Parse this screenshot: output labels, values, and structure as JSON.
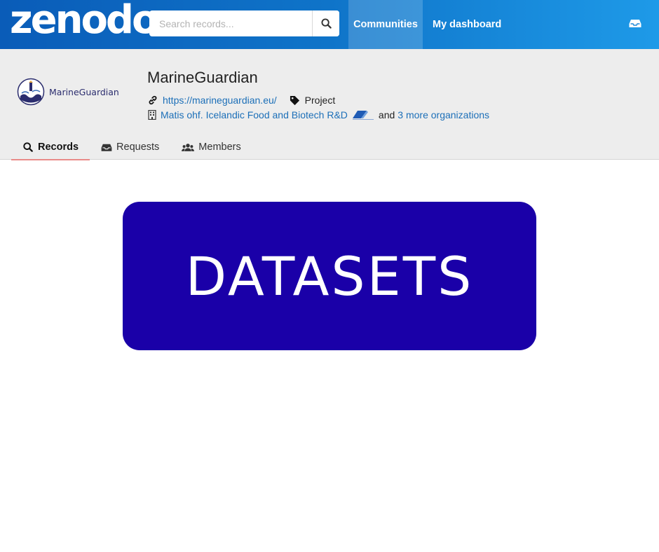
{
  "header": {
    "logo_text": "zenodo",
    "search": {
      "placeholder": "Search records..."
    },
    "nav": {
      "communities": "Communities",
      "dashboard": "My dashboard"
    }
  },
  "community": {
    "logo_text": "MarineGuardian",
    "title": "MarineGuardian",
    "website": "https://marineguardian.eu/",
    "type": "Project",
    "organization": "Matis ohf. Icelandic Food and Biotech R&D",
    "and_text": "and",
    "more_orgs": "3 more organizations"
  },
  "tabs": [
    {
      "label": "Records",
      "icon": "search-icon",
      "active": true
    },
    {
      "label": "Requests",
      "icon": "inbox-icon",
      "active": false
    },
    {
      "label": "Members",
      "icon": "users-icon",
      "active": false
    }
  ],
  "banner": {
    "text": "DATASETS",
    "color": "#1a00a8"
  },
  "colors": {
    "topbar_start": "#0a5cb8",
    "topbar_end": "#1e9ae8",
    "link": "#1c6fb8",
    "active_tab_underline": "#e98b89"
  }
}
